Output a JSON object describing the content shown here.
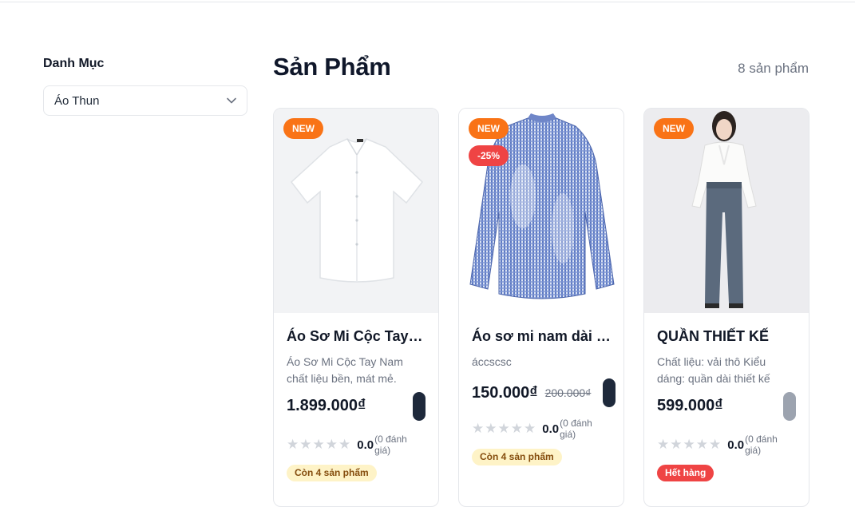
{
  "sidebar": {
    "title": "Danh Mục",
    "category_select": {
      "value": "Áo Thun"
    }
  },
  "main": {
    "heading": "Sản Phẩm",
    "count": "8 sản phẩm",
    "products": [
      {
        "badge_new": "NEW",
        "name": "Áo Sơ Mi Cộc Tay Nam",
        "description": "Áo Sơ Mi Cộc Tay Nam chất liệu bền, mát mẻ.",
        "price": "1.899.000₫",
        "rating": "0.0",
        "rating_count": "(0 đánh giá)",
        "stock": "Còn 4 sản phẩm",
        "stars": 0
      },
      {
        "badge_new": "NEW",
        "badge_sale": "-25%",
        "name": "Áo sơ mi nam dài tay",
        "description": "áccscsc",
        "price": "150.000₫",
        "old_price": "200.000₫",
        "rating": "0.0",
        "rating_count": "(0 đánh giá)",
        "stock": "Còn 4 sản phẩm",
        "stars": 0
      },
      {
        "badge_new": "NEW",
        "name": "QUẦN THIẾT KẾ",
        "description": "Chất liệu: vải thô Kiểu dáng: quần dài thiết kế",
        "price": "599.000₫",
        "rating": "0.0",
        "rating_count": "(0 đánh giá)",
        "stock": "Hết hàng",
        "stars": 0
      }
    ]
  },
  "icons": {
    "select_chevron": "chevron-down-icon",
    "star": "star-icon"
  },
  "colors": {
    "badge_new": "#f97316",
    "badge_sale": "#ef4444",
    "stock_available_bg": "#fef3c7",
    "stock_out_bg": "#ef4444",
    "cart_button": "#1e293b"
  }
}
